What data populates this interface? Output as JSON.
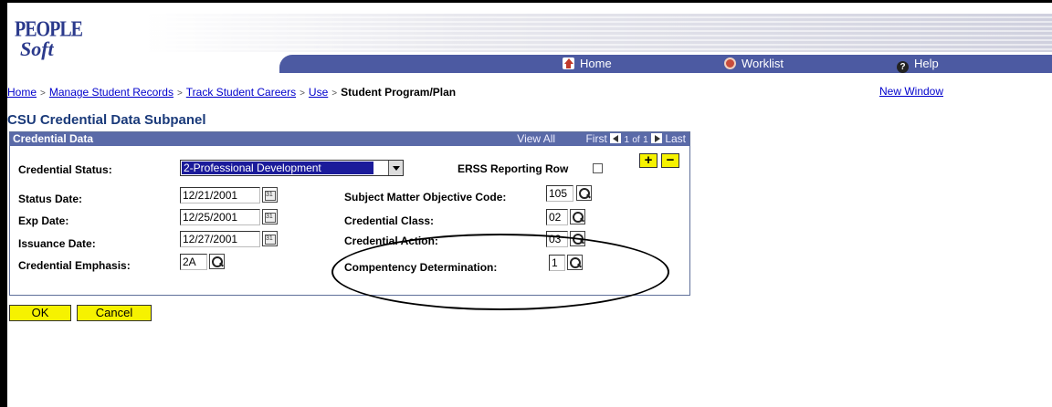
{
  "header": {
    "logo_people": "PEOPLE",
    "logo_soft": "Soft",
    "nav": {
      "home": "Home",
      "worklist": "Worklist",
      "help": "Help"
    }
  },
  "breadcrumb": {
    "items": [
      "Home",
      "Manage Student Records",
      "Track Student Careers",
      "Use"
    ],
    "current": "Student Program/Plan",
    "separator": ">"
  },
  "new_window": "New Window",
  "page_title": "CSU Credential Data Subpanel",
  "group": {
    "title": "Credential Data",
    "view_all": "View All",
    "first": "First",
    "counter_a": "1",
    "counter_of": "of",
    "counter_b": "1",
    "last": "Last"
  },
  "fields": {
    "credential_status": {
      "label": "Credential Status:",
      "value": "2-Professional Development"
    },
    "erss_reporting_row": {
      "label": "ERSS Reporting Row",
      "checked": false
    },
    "status_date": {
      "label": "Status Date:",
      "value": "12/21/2001"
    },
    "exp_date": {
      "label": "Exp Date:",
      "value": "12/25/2001"
    },
    "issuance_date": {
      "label": "Issuance Date:",
      "value": "12/27/2001"
    },
    "credential_emphasis": {
      "label": "Credential Emphasis:",
      "value": "2A"
    },
    "subject_matter_objective_code": {
      "label": "Subject Matter Objective Code:",
      "value": "105"
    },
    "credential_class": {
      "label": "Credential Class:",
      "value": "02"
    },
    "credential_action": {
      "label": "Credential Action:",
      "value": "03"
    },
    "competency_determination": {
      "label": "Compentency Determination:",
      "value": "1"
    }
  },
  "row_buttons": {
    "add": "+",
    "delete": "−"
  },
  "buttons": {
    "ok": "OK",
    "cancel": "Cancel"
  },
  "colors": {
    "nav_bar": "#4c5aa2",
    "group_header": "#5a6aa8",
    "title": "#1a3a7a",
    "link": "#0000cc",
    "button_yellow": "#f6f200"
  }
}
